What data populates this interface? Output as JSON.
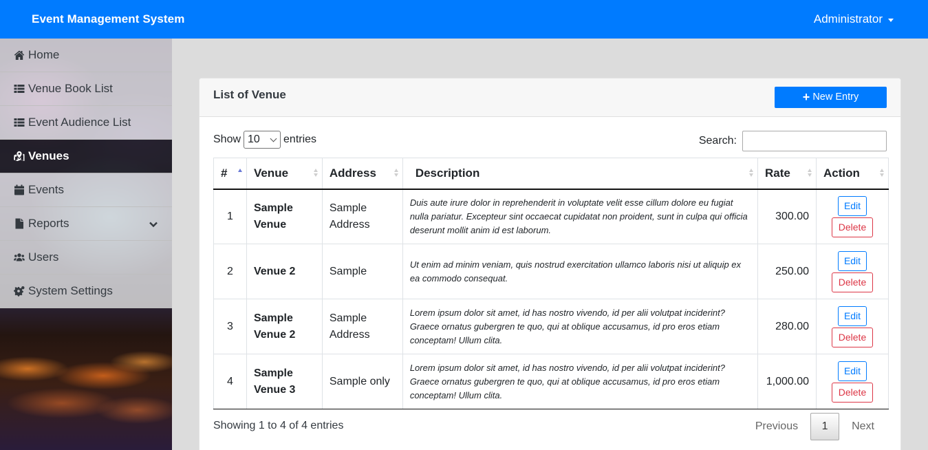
{
  "app": {
    "title": "Event Management System",
    "user": "Administrator"
  },
  "sidebar": {
    "items": [
      {
        "label": "Home",
        "icon": "home-icon"
      },
      {
        "label": "Venue Book List",
        "icon": "list-icon"
      },
      {
        "label": "Event Audience List",
        "icon": "list-icon"
      },
      {
        "label": "Venues",
        "icon": "map-marked-icon",
        "active": true
      },
      {
        "label": "Events",
        "icon": "calendar-icon"
      },
      {
        "label": "Reports",
        "icon": "file-icon",
        "has_submenu": true
      },
      {
        "label": "Users",
        "icon": "users-icon"
      },
      {
        "label": "System Settings",
        "icon": "cogs-icon"
      }
    ]
  },
  "card": {
    "title": "List of Venue",
    "new_entry_label": "New Entry"
  },
  "controls": {
    "show_label": "Show",
    "entries_value": "10",
    "entries_label": "entries",
    "search_label": "Search:",
    "search_value": ""
  },
  "table": {
    "headers": [
      "#",
      "Venue",
      "Address",
      "Description",
      "Rate",
      "Action"
    ],
    "rows": [
      {
        "num": "1",
        "venue": "Sample Venue",
        "address": "Sample Address",
        "description": "Duis aute irure dolor in reprehenderit in voluptate velit esse cillum dolore eu fugiat nulla pariatur. Excepteur sint occaecat cupidatat non proident, sunt in culpa qui officia deserunt mollit anim id est laborum.",
        "rate": "300.00"
      },
      {
        "num": "2",
        "venue": "Venue 2",
        "address": "Sample",
        "description": "Ut enim ad minim veniam, quis nostrud exercitation ullamco laboris nisi ut aliquip ex ea commodo consequat.",
        "rate": "250.00"
      },
      {
        "num": "3",
        "venue": "Sample Venue 2",
        "address": "Sample Address",
        "description": "Lorem ipsum dolor sit amet, id has nostro vivendo, id per alii volutpat inciderint? Graece ornatus gubergren te quo, qui at oblique accusamus, id pro eros etiam conceptam! Ullum clita.",
        "rate": "280.00"
      },
      {
        "num": "4",
        "venue": "Sample Venue 3",
        "address": "Sample only",
        "description": "Lorem ipsum dolor sit amet, id has nostro vivendo, id per alii volutpat inciderint? Graece ornatus gubergren te quo, qui at oblique accusamus, id pro eros etiam conceptam! Ullum clita.",
        "rate": "1,000.00"
      }
    ],
    "edit_label": "Edit",
    "delete_label": "Delete"
  },
  "footer": {
    "info": "Showing 1 to 4 of 4 entries",
    "previous": "Previous",
    "page": "1",
    "next": "Next"
  },
  "colors": {
    "primary": "#007bff",
    "danger": "#dc3545",
    "active_nav": "#141414"
  }
}
